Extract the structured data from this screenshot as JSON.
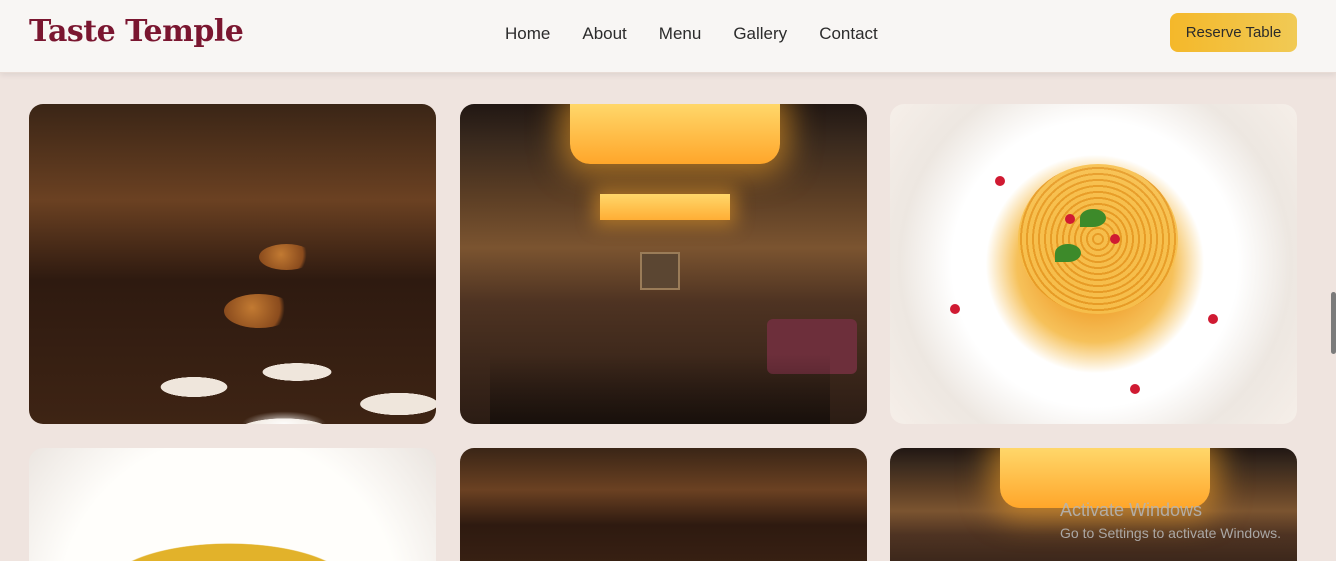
{
  "brand": "Taste Temple",
  "nav": [
    "Home",
    "About",
    "Menu",
    "Gallery",
    "Contact"
  ],
  "cta": "Reserve Table",
  "gallery": [
    {
      "name": "gallery-image-dining-table"
    },
    {
      "name": "gallery-image-restaurant-interior"
    },
    {
      "name": "gallery-image-pasta-dish"
    },
    {
      "name": "gallery-image-soup-dish"
    },
    {
      "name": "gallery-image-dining-table-2"
    },
    {
      "name": "gallery-image-restaurant-interior-2"
    }
  ],
  "watermark": {
    "line1": "Activate Windows",
    "line2": "Go to Settings to activate Windows."
  },
  "colors": {
    "brand": "#7a1630",
    "accent": "#f4b82a",
    "page_background": "#efe4df"
  }
}
